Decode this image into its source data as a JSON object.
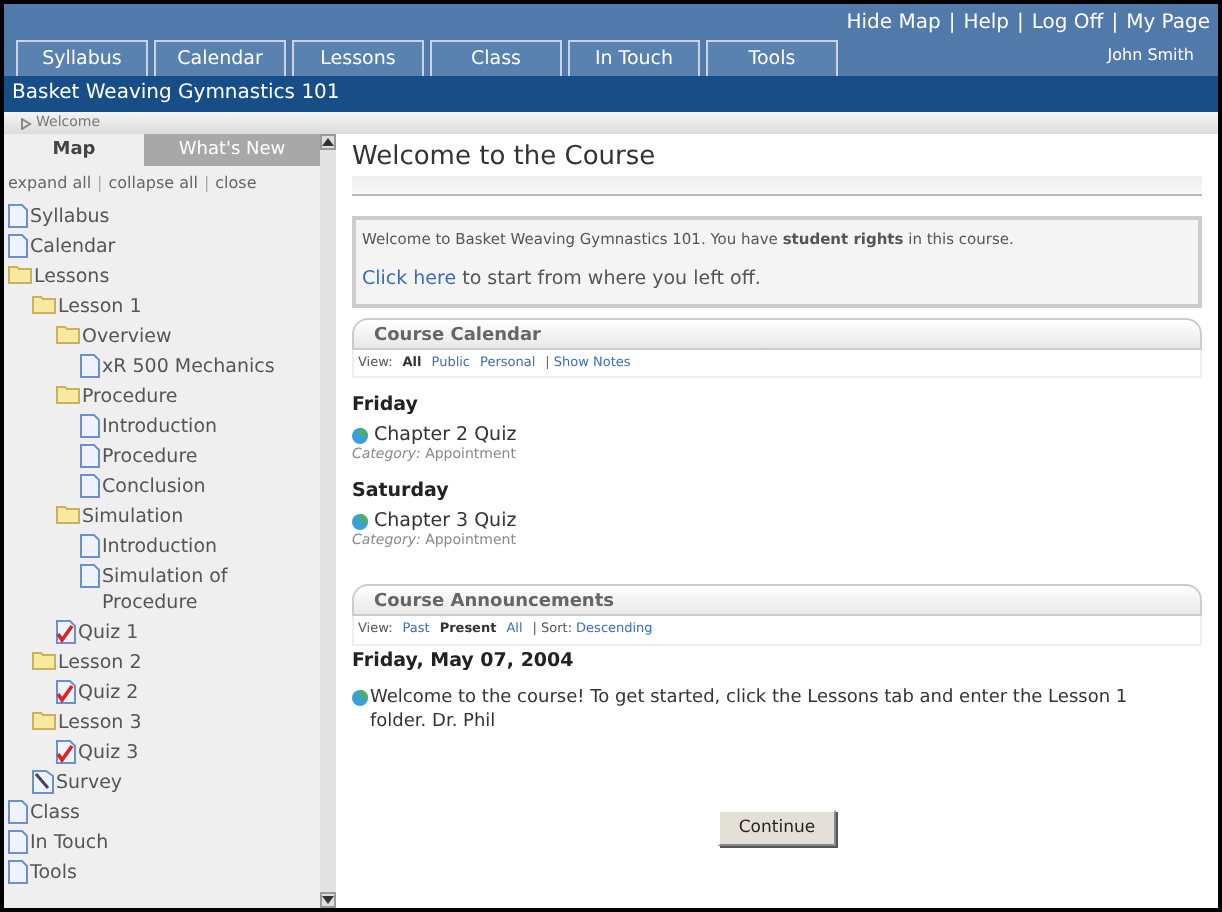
{
  "top_links": [
    "Hide Map",
    "Help",
    "Log Off",
    "My Page"
  ],
  "link_separator": "|",
  "user": "John Smith",
  "tabs": [
    "Syllabus",
    "Calendar",
    "Lessons",
    "Class",
    "In Touch",
    "Tools"
  ],
  "course_title": "Basket Weaving Gymnastics 101",
  "breadcrumb": "Welcome",
  "sidebar": {
    "tabs": [
      {
        "label": "Map",
        "selected": true
      },
      {
        "label": "What's New",
        "selected": false
      }
    ],
    "actions": [
      "expand all",
      "collapse all",
      "close"
    ],
    "tree": [
      {
        "kind": "page",
        "label": "Syllabus"
      },
      {
        "kind": "page",
        "label": "Calendar"
      },
      {
        "kind": "folder",
        "label": "Lessons",
        "children": [
          {
            "kind": "folder",
            "label": "Lesson 1",
            "children": [
              {
                "kind": "folder",
                "label": "Overview",
                "children": [
                  {
                    "kind": "page",
                    "label": "xR 500 Mechanics"
                  }
                ]
              },
              {
                "kind": "folder",
                "label": "Procedure",
                "children": [
                  {
                    "kind": "page",
                    "label": "Introduction"
                  },
                  {
                    "kind": "page",
                    "label": "Procedure"
                  },
                  {
                    "kind": "page",
                    "label": "Conclusion"
                  }
                ]
              },
              {
                "kind": "folder",
                "label": "Simulation",
                "children": [
                  {
                    "kind": "page",
                    "label": "Introduction"
                  },
                  {
                    "kind": "page",
                    "label": "Simulation of Procedure"
                  }
                ]
              },
              {
                "kind": "quiz",
                "label": "Quiz 1"
              }
            ]
          },
          {
            "kind": "folder",
            "label": "Lesson 2",
            "children": [
              {
                "kind": "quiz",
                "label": "Quiz 2"
              }
            ]
          },
          {
            "kind": "folder",
            "label": "Lesson 3",
            "children": [
              {
                "kind": "quiz",
                "label": "Quiz 3"
              }
            ]
          },
          {
            "kind": "survey",
            "label": "Survey"
          }
        ]
      },
      {
        "kind": "page",
        "label": "Class"
      },
      {
        "kind": "page",
        "label": "In Touch"
      },
      {
        "kind": "page",
        "label": "Tools"
      }
    ]
  },
  "main": {
    "title": "Welcome to the Course",
    "welcome": {
      "text": "Welcome to Basket Weaving Gymnastics 101. You have **student rights** in this course.",
      "link": "Click here",
      "link_rest": "to start from where you left off."
    },
    "calendar": {
      "title": "Course Calendar",
      "view_label": "View:",
      "views": [
        {
          "label": "All",
          "selected": true
        },
        {
          "label": "Public",
          "selected": false
        },
        {
          "label": "Personal",
          "selected": false
        }
      ],
      "extra": "| Show Notes",
      "days": [
        {
          "day": "Friday",
          "events": [
            {
              "title": "Chapter 2 Quiz",
              "category_label": "Category:",
              "category": "Appointment"
            }
          ]
        },
        {
          "day": "Saturday",
          "events": [
            {
              "title": "Chapter 3 Quiz",
              "category_label": "Category:",
              "category": "Appointment"
            }
          ]
        }
      ]
    },
    "announcements": {
      "title": "Course Announcements",
      "view_label": "View:",
      "views": [
        {
          "label": "Past",
          "selected": false
        },
        {
          "label": "Present",
          "selected": true
        },
        {
          "label": "All",
          "selected": false
        }
      ],
      "sort_label": "| Sort:",
      "sort": "Descending",
      "date": "Friday, May 07, 2004",
      "message": "Welcome to the course! To get started, click the Lessons tab and enter the Lesson 1 folder. Dr. Phil"
    },
    "continue_button": "Continue"
  }
}
